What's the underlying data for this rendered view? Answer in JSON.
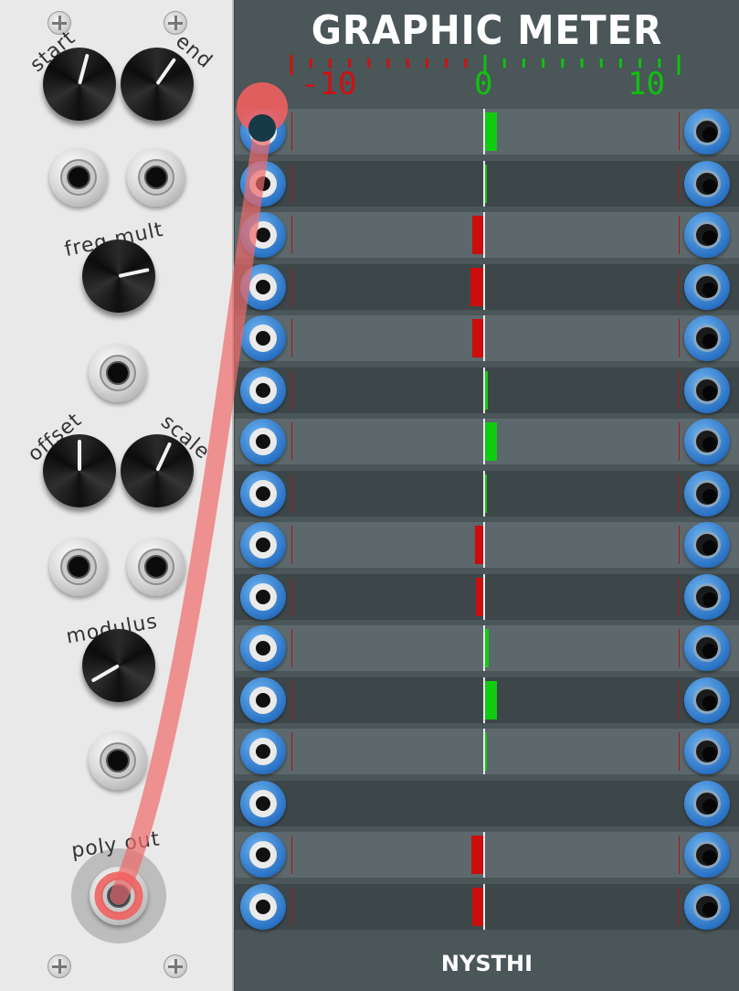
{
  "left_module": {
    "labels": {
      "start": "start",
      "end": "end",
      "freq_mult": "freq mult",
      "offset": "offset",
      "scale": "scale",
      "modulus": "modulus",
      "poly_out": "poly out"
    }
  },
  "meter": {
    "title": "GRAPHIC METER",
    "scale": {
      "min_label": "-10",
      "zero_label": "0",
      "max_label": "10",
      "min": -10,
      "max": 10
    },
    "channels": [
      1.6,
      0.1,
      -1.5,
      -1.7,
      -1.4,
      0.4,
      1.5,
      0.3,
      -1.1,
      -1.0,
      0.6,
      1.6,
      0.2,
      null,
      -1.6,
      -1.4
    ],
    "brand": "NYSTHI"
  },
  "colors": {
    "positive_bar": "#10cc10",
    "negative_bar": "#cc0d0d",
    "cable": "#f06060",
    "jack_blue": "#2a72c4"
  }
}
